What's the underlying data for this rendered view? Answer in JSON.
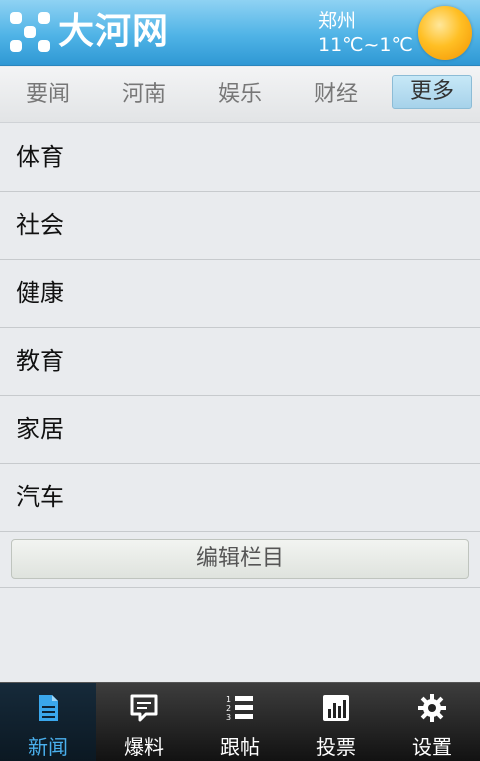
{
  "header": {
    "logo_text": "大河网",
    "city": "郑州",
    "temperature": "11℃~1℃",
    "weather_icon": "sun-icon"
  },
  "tabs": [
    {
      "label": "要闻",
      "active": false
    },
    {
      "label": "河南",
      "active": false
    },
    {
      "label": "娱乐",
      "active": false
    },
    {
      "label": "财经",
      "active": false
    },
    {
      "label": "更多",
      "active": true
    }
  ],
  "more_list": {
    "items": [
      "体育",
      "社会",
      "健康",
      "教育",
      "家居",
      "汽车"
    ],
    "edit_button_label": "编辑栏目"
  },
  "bottom_nav": [
    {
      "label": "新闻",
      "icon": "document-icon",
      "active": true
    },
    {
      "label": "爆料",
      "icon": "speech-bubble-icon",
      "active": false
    },
    {
      "label": "跟帖",
      "icon": "numbered-list-icon",
      "active": false
    },
    {
      "label": "投票",
      "icon": "bar-chart-icon",
      "active": false
    },
    {
      "label": "设置",
      "icon": "gear-icon",
      "active": false
    }
  ],
  "colors": {
    "header_blue": "#4fb3e6",
    "active_tab": "#a6d2ea",
    "nav_active_label": "#4ab0ee"
  }
}
